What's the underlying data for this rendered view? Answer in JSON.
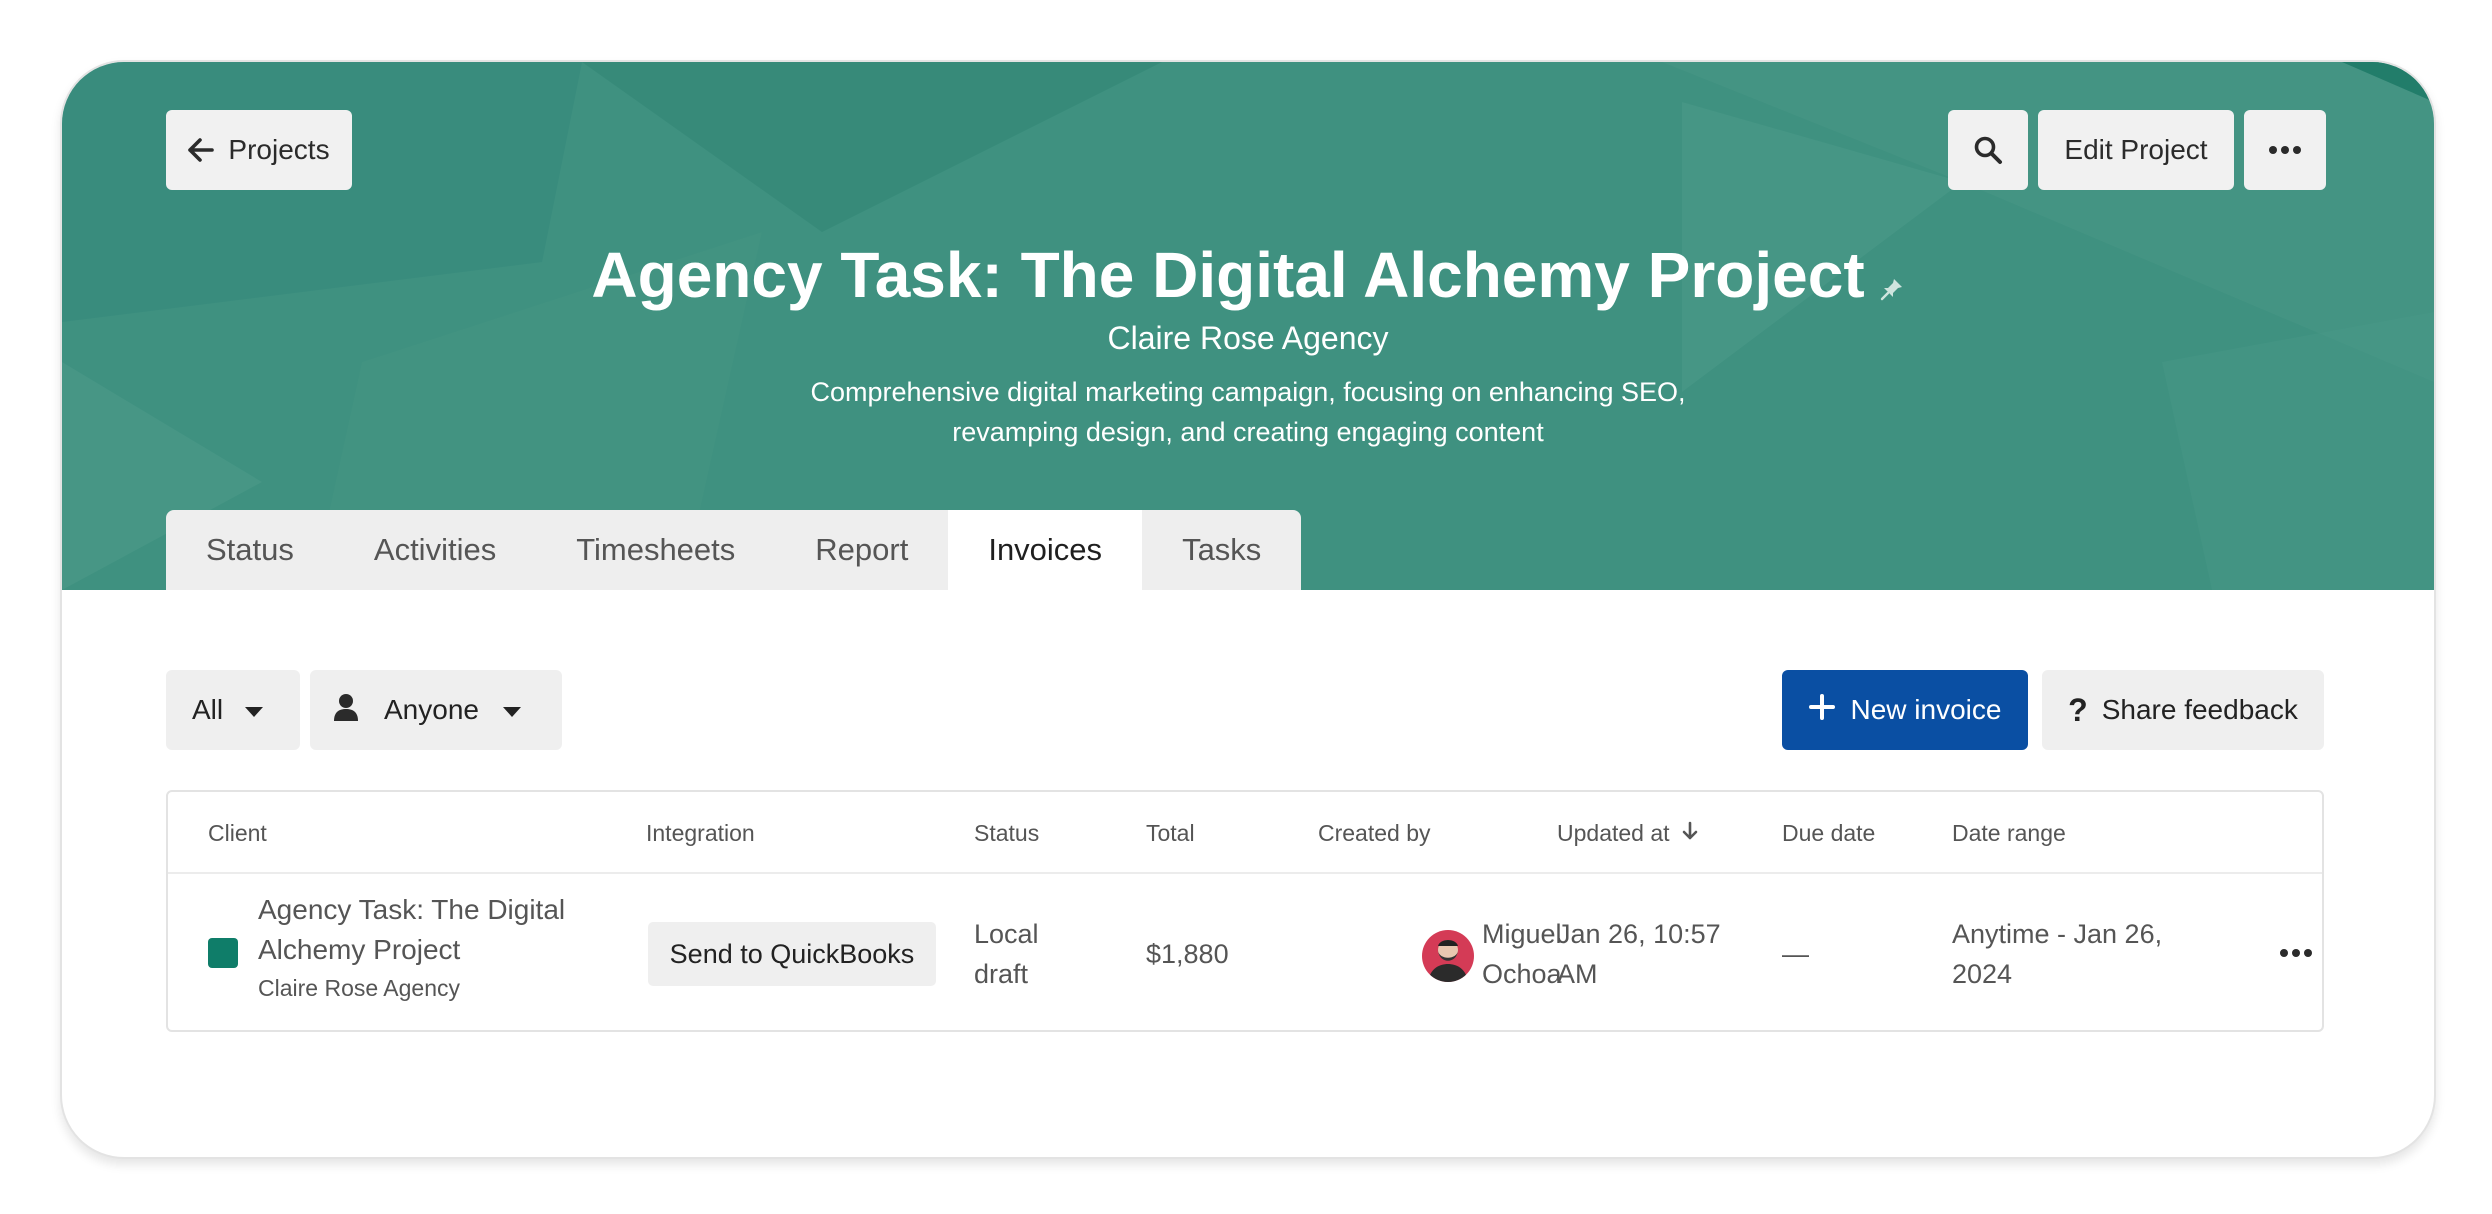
{
  "header": {
    "back_label": "Projects",
    "edit_label": "Edit Project",
    "title": "Agency Task: The Digital Alchemy Project",
    "client": "Claire Rose Agency",
    "description_line1": "Comprehensive digital marketing campaign, focusing on enhancing SEO,",
    "description_line2": "revamping design, and creating engaging content"
  },
  "tabs": [
    "Status",
    "Activities",
    "Timesheets",
    "Report",
    "Invoices",
    "Tasks"
  ],
  "active_tab": "Invoices",
  "filters": {
    "status": "All",
    "person": "Anyone"
  },
  "actions": {
    "new_invoice": "New invoice",
    "share_feedback": "Share feedback"
  },
  "table": {
    "columns": [
      "Client",
      "Integration",
      "Status",
      "Total",
      "Created by",
      "Updated at",
      "Due date",
      "Date range"
    ],
    "rows": [
      {
        "client_line1": "Agency Task: The Digital",
        "client_line2": "Alchemy Project",
        "client_sub": "Claire Rose Agency",
        "integration": "Send to QuickBooks",
        "status_line1": "Local",
        "status_line2": "draft",
        "total": "$1,880",
        "created_by_line1": "Miguel",
        "created_by_line2": "Ochoa",
        "updated_line1": "Jan 26, 10:57",
        "updated_line2": "AM",
        "due_date": "—",
        "range_line1": "Anytime - Jan 26,",
        "range_line2": "2024"
      }
    ]
  },
  "colors": {
    "hero": "#3f9180",
    "primary": "#0a4fa3",
    "client_swatch": "#0f7d69",
    "avatar": "#d43b56"
  },
  "icons": [
    "arrow-left-icon",
    "search-icon",
    "more-horizontal-icon",
    "pin-icon",
    "caret-down-icon",
    "person-icon",
    "plus-icon",
    "question-icon",
    "arrow-down-icon"
  ]
}
